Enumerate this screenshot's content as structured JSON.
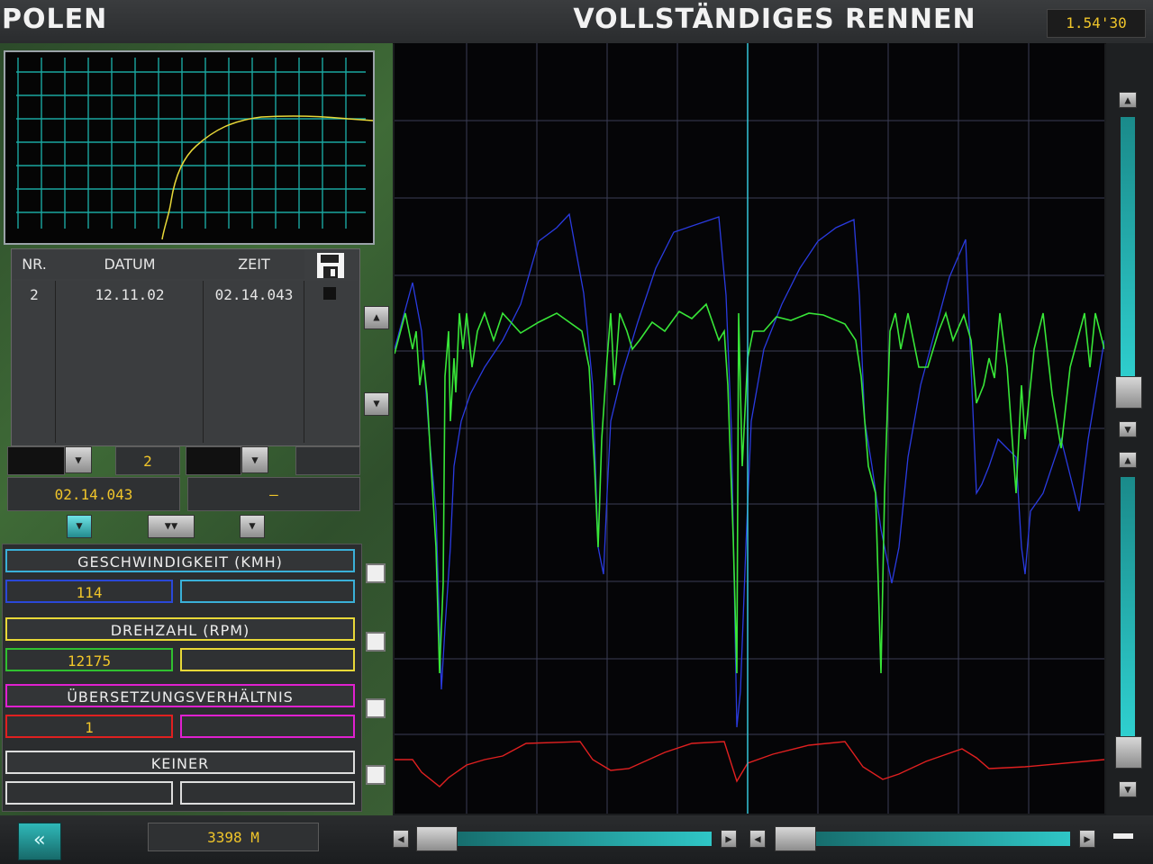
{
  "header": {
    "track": "POLEN",
    "mode": "VOLLSTÄNDIGES RENNEN",
    "lap_time": "1.54'30"
  },
  "table": {
    "headers": [
      "NR.",
      "DATUM",
      "ZEIT"
    ],
    "save_icon": "floppy-disk-icon",
    "rows": [
      {
        "nr": "2",
        "datum": "12.11.02",
        "zeit": "02.14.043"
      }
    ]
  },
  "selectors": {
    "lap_nr": "2",
    "lap_time_a": "02.14.043",
    "lap_time_b": "–"
  },
  "channels": [
    {
      "name": "GESCHWINDIGKEIT (KMH)",
      "value": "114",
      "color": "#2a48d8",
      "frame": "#3ab0d8"
    },
    {
      "name": "DREHZAHL (RPM)",
      "value": "12175",
      "color": "#30e030",
      "frame": "#e8d838"
    },
    {
      "name": "ÜBERSETZUNGSVERHÄLTNIS",
      "value": "1",
      "color": "#e02020",
      "frame": "#e020d0"
    },
    {
      "name": "KEINER",
      "value": "",
      "color": "#cccccc",
      "frame": "#dddddd"
    }
  ],
  "footer": {
    "distance": "3398 M",
    "back_icon": "double-chevron-left-icon"
  }
}
